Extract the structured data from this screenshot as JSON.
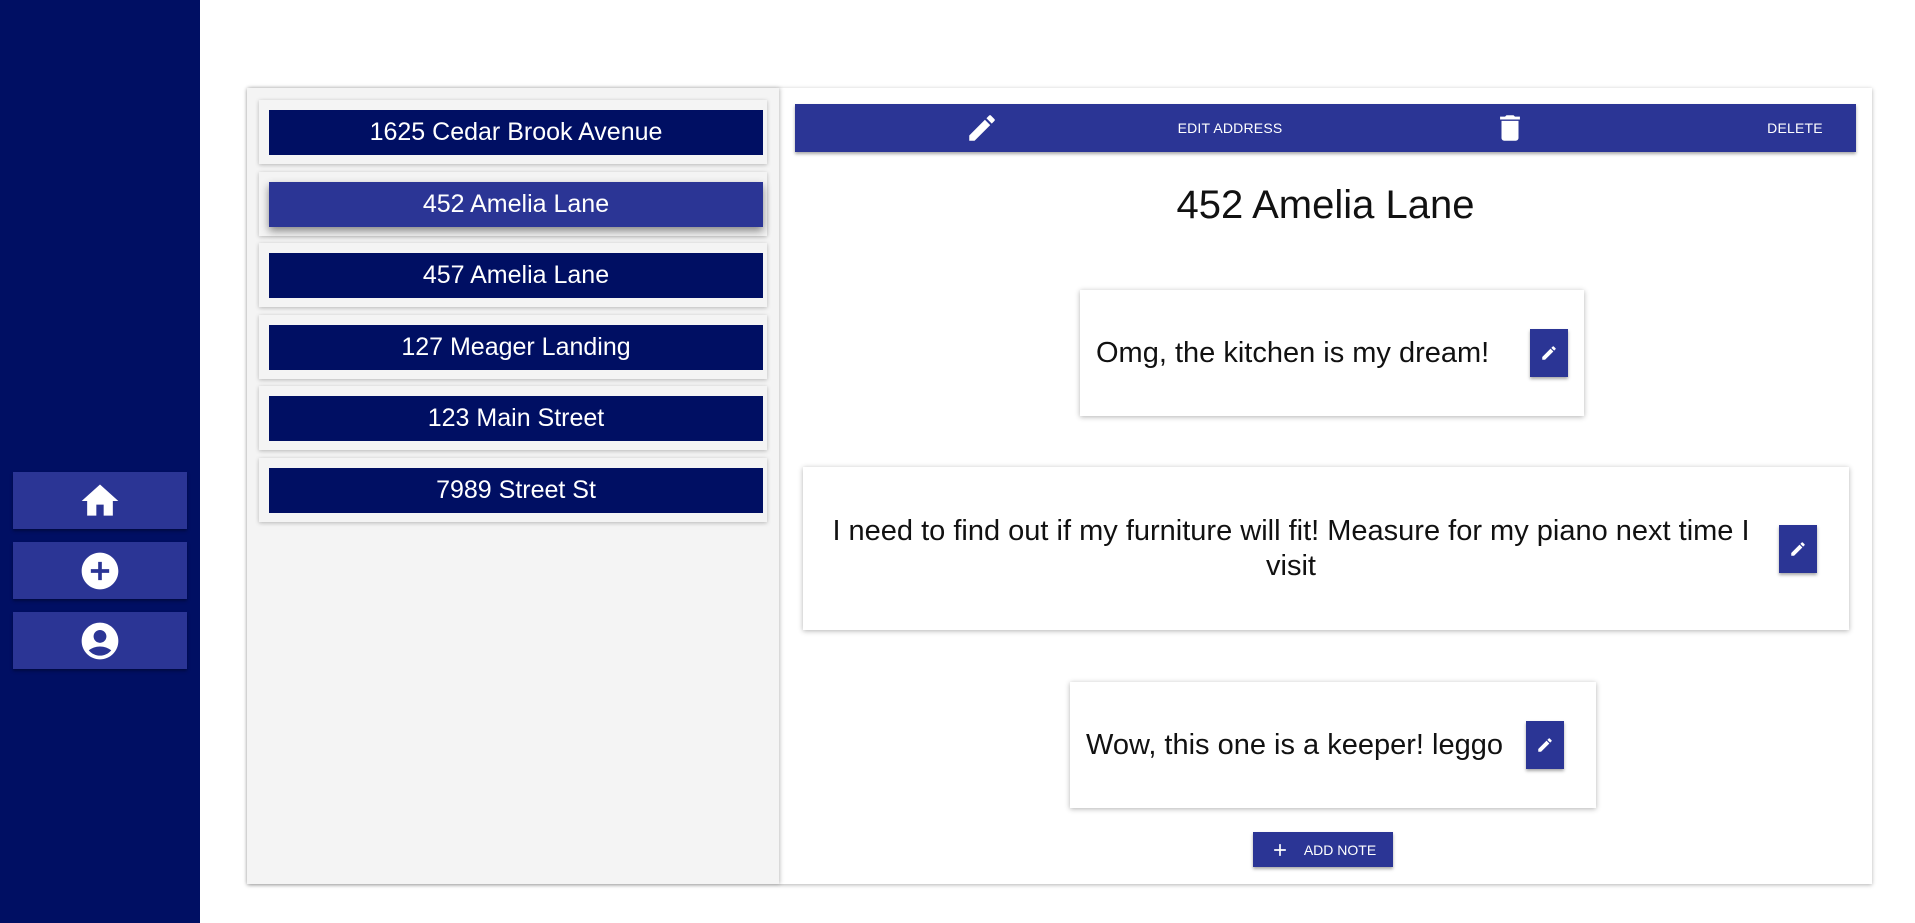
{
  "sidebar": {
    "items": [
      {
        "icon": "home-icon"
      },
      {
        "icon": "add-circle-icon"
      },
      {
        "icon": "account-circle-icon"
      }
    ]
  },
  "addresses": [
    {
      "label": "1625 Cedar Brook Avenue",
      "selected": false
    },
    {
      "label": "452 Amelia Lane",
      "selected": true
    },
    {
      "label": "457 Amelia Lane",
      "selected": false
    },
    {
      "label": "127 Meager Landing",
      "selected": false
    },
    {
      "label": "123 Main Street",
      "selected": false
    },
    {
      "label": "7989 Street St",
      "selected": false
    }
  ],
  "toolbar": {
    "edit_label": "EDIT ADDRESS",
    "delete_label": "DELETE",
    "edit_icon": "pencil-icon",
    "delete_icon": "trash-icon"
  },
  "detail": {
    "title": "452 Amelia Lane",
    "notes": [
      {
        "text": "Omg, the kitchen is my dream!"
      },
      {
        "text": "I need to find out if my furniture will fit! Measure for my piano next time I visit"
      },
      {
        "text": "Wow, this one is a keeper! leggo"
      }
    ],
    "add_note_label": "ADD NOTE"
  },
  "colors": {
    "sidebar": "#000f63",
    "accent": "#2b3595",
    "panel": "#f4f4f4"
  }
}
